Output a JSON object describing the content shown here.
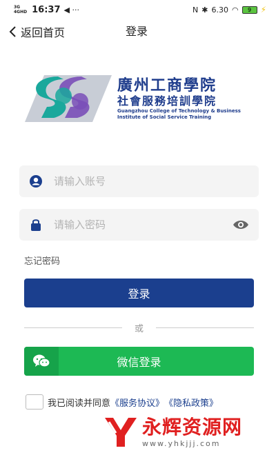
{
  "status_bar": {
    "network_top": "3G",
    "network_bottom": "4GHD",
    "time": "16:37",
    "extra_icons": "◀ ···",
    "speed": "6.30",
    "battery": "9"
  },
  "nav": {
    "back_label": "返回首页",
    "title": "登录"
  },
  "logo": {
    "name_cn_line1": "廣州工商學院",
    "name_cn_line2": "社會服務培訓學院",
    "name_en_line1": "Guangzhou College of Technology & Business",
    "name_en_line2": "Institute of Social Service Training",
    "colors": {
      "purple": "#7a4fb8",
      "teal": "#1aa89c",
      "navy": "#1e3c8c"
    }
  },
  "form": {
    "account_placeholder": "请输入账号",
    "account_value": "",
    "password_placeholder": "请输入密码",
    "password_value": "",
    "forgot_label": "忘记密码",
    "login_label": "登录",
    "or_label": "或",
    "wechat_label": "微信登录",
    "agree_text": "我已阅读并同意",
    "terms_label": "《服务协议》",
    "privacy_label": "《隐私政策》"
  },
  "watermark": {
    "name": "永辉资源网",
    "url": "www.yhkjjj.com"
  },
  "colors": {
    "primary": "#1b3f8e",
    "wechat": "#1db954",
    "input_bg": "#f4f4f4"
  },
  "icons": [
    "back-chevron-icon",
    "user-icon",
    "lock-icon",
    "eye-icon",
    "wechat-icon"
  ]
}
